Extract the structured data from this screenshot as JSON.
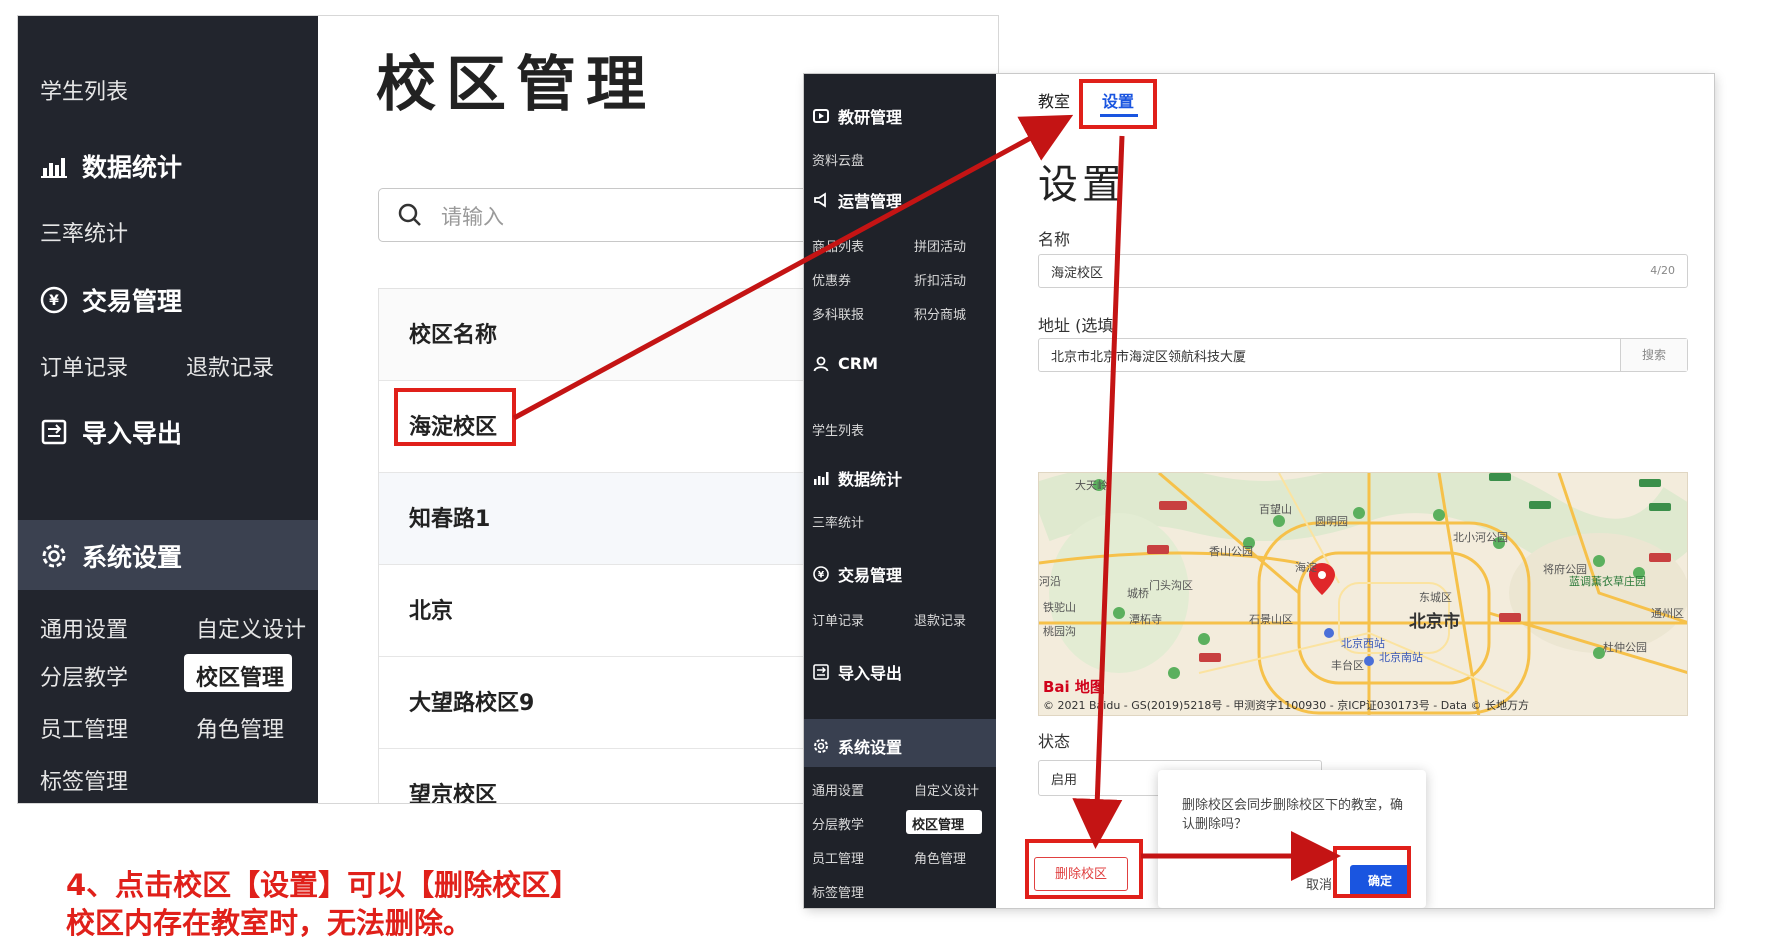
{
  "left": {
    "sidebar": {
      "student_list": "学生列表",
      "data_stats": "数据统计",
      "three_rate": "三率统计",
      "trade_mgmt": "交易管理",
      "order_record": "订单记录",
      "refund_record": "退款记录",
      "import_export": "导入导出",
      "system_settings": "系统设置",
      "general_settings": "通用设置",
      "custom_design": "自定义设计",
      "tiered_teaching": "分层教学",
      "campus_mgmt": "校区管理",
      "staff_mgmt": "员工管理",
      "role_mgmt": "角色管理",
      "tag_mgmt": "标签管理"
    },
    "main": {
      "title": "校区管理",
      "search_placeholder": "请输入",
      "table_header": "校区名称",
      "rows": [
        "海淀校区",
        "知春路1",
        "北京",
        "大望路校区9",
        "望京校区"
      ]
    }
  },
  "right": {
    "sidebar": {
      "teaching_research": "教研管理",
      "resource_cloud": "资料云盘",
      "operations": "运营管理",
      "product_list": "商品列表",
      "group_buy": "拼团活动",
      "coupon": "优惠券",
      "discount": "折扣活动",
      "multi_subject": "多科联报",
      "points_mall": "积分商城",
      "crm": "CRM",
      "student_list": "学生列表",
      "data_stats": "数据统计",
      "three_rate": "三率统计",
      "trade_mgmt": "交易管理",
      "order_record": "订单记录",
      "refund_record": "退款记录",
      "import_export": "导入导出",
      "system_settings": "系统设置",
      "general_settings": "通用设置",
      "custom_design": "自定义设计",
      "tiered_teaching": "分层教学",
      "campus_mgmt": "校区管理",
      "staff_mgmt": "员工管理",
      "role_mgmt": "角色管理",
      "tag_mgmt": "标签管理"
    },
    "main": {
      "tab_classroom": "教室",
      "tab_settings": "设置",
      "title": "设置",
      "name_label": "名称",
      "name_value": "海淀校区",
      "name_count": "4/20",
      "address_label": "地址 (选填",
      "address_value": "北京市北京市海淀区领航科技大厦",
      "search_button": "搜索",
      "status_label": "状态",
      "status_value": "启用",
      "popover_message": "删除校区会同步删除校区下的教室，确认删除吗？",
      "cancel": "取消",
      "confirm": "确定",
      "delete_campus": "删除校区"
    },
    "map": {
      "logo": "Bai 地图",
      "copyright": "© 2021 Baidu - GS(2019)5218号 - 甲测资字1100930 - 京ICP证030173号 - Data © 长地万方",
      "labels": {
        "tiankai": "大天岭",
        "baiwang": "百望山",
        "yuanmingyuan": "圆明园",
        "xiangshan": "香山公园",
        "beixiaohe": "北小河公园",
        "haidian": "海淀",
        "jiangfu": "将府公园",
        "menutou": "门头沟区",
        "dongcheng": "东城区",
        "tielongshan": "铁驼山",
        "tanzhe": "潭柘寺",
        "shijingshan": "石景山区",
        "beijing": "北京市",
        "tongzhou": "通州区",
        "beijingxi": "北京西站",
        "fengtai": "丰台区",
        "beijingnan": "北京南站",
        "dushi": "杜仲公园",
        "lavender": "蓝调薰衣草庄园",
        "taoyuan": "桃园沟",
        "hexi": "河沿",
        "yuanqiao": "城桥"
      }
    }
  },
  "caption": {
    "line1": "4、点击校区【设置】可以【删除校区】",
    "line2": "校区内存在教室时，无法删除。"
  },
  "colors": {
    "annotation_red": "#e0201a",
    "sidebar_dark": "#22252d",
    "primary_blue": "#1a55e0"
  }
}
